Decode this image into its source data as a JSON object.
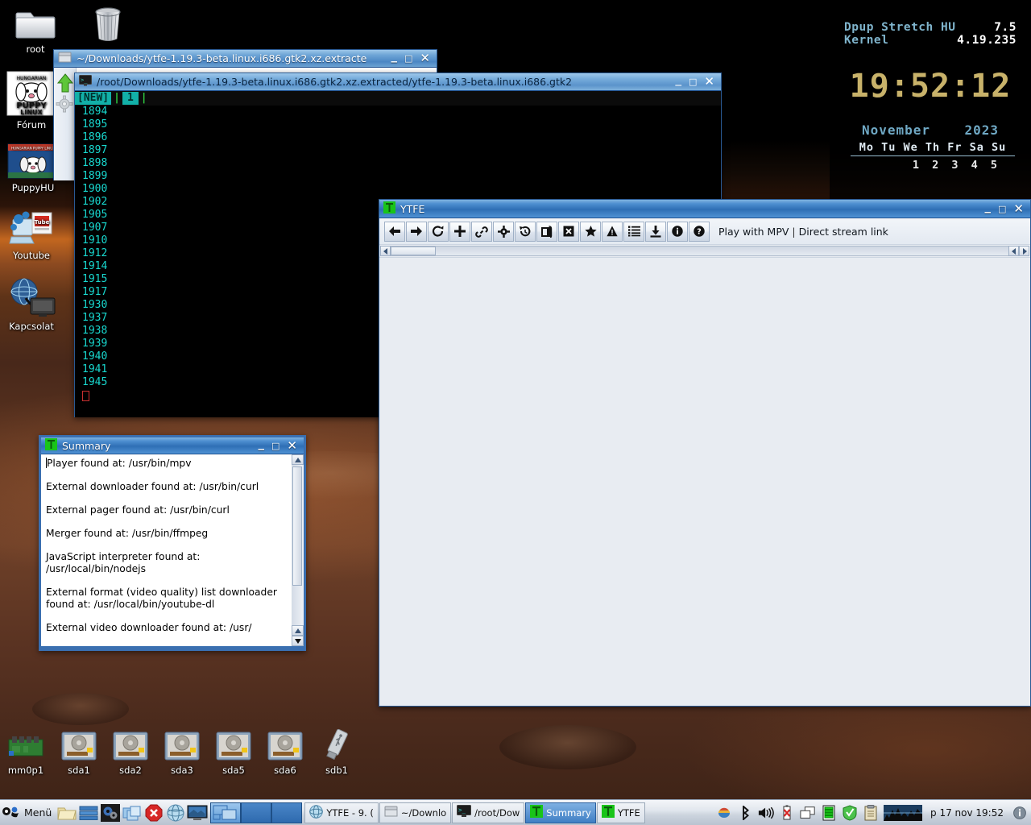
{
  "desktop": {
    "icons": [
      {
        "name": "root",
        "icon": "folder-icon"
      },
      {
        "name": "",
        "icon": "trash-icon"
      },
      {
        "name": "Fórum",
        "icon": "puppy-linux-forum-icon"
      },
      {
        "name": "PuppyHU",
        "icon": "puppyhu-icon"
      },
      {
        "name": "Youtube",
        "icon": "youtube-icon"
      },
      {
        "name": "Kapcsolat",
        "icon": "network-connect-icon"
      }
    ],
    "drives": [
      {
        "label": "mm0p1",
        "icon": "card-reader-icon"
      },
      {
        "label": "sda1",
        "icon": "harddisk-icon"
      },
      {
        "label": "sda2",
        "icon": "harddisk-icon"
      },
      {
        "label": "sda3",
        "icon": "harddisk-icon"
      },
      {
        "label": "sda5",
        "icon": "harddisk-icon"
      },
      {
        "label": "sda6",
        "icon": "harddisk-icon"
      },
      {
        "label": "sdb1",
        "icon": "usb-drive-icon"
      }
    ]
  },
  "conky": {
    "distro_label": "Dpup Stretch HU",
    "distro_version": "7.5",
    "kernel_label": "Kernel",
    "kernel_version": "4.19.235",
    "clock": "19:52:12",
    "month": "November",
    "year": "2023",
    "weekday_header": "Mo Tu We Th Fr Sa Su",
    "first_week": "1  2  3  4  5"
  },
  "filemanager": {
    "title": "~/Downloads/ytfe-1.19.3-beta.linux.i686.gtk2.xz.extracte",
    "icon": "folder-window-icon",
    "sidebar": [
      "up-arrow-icon",
      "gear-icon"
    ]
  },
  "terminal": {
    "title": "/root/Downloads/ytfe-1.19.3-beta.linux.i686.gtk2.xz.extracted/ytfe-1.19.3-beta.linux.i686.gtk2",
    "icon": "terminal-icon",
    "status_tag": "[NEW]",
    "status_num": "1",
    "lines": [
      "1894",
      "1895",
      "1896",
      "1897",
      "1898",
      "1899",
      "1900",
      "1902",
      "1905",
      "1907",
      "1910",
      "1912",
      "1914",
      "1915",
      "1917",
      "1930",
      "1937",
      "1938",
      "1939",
      "1940",
      "1941",
      "1945"
    ]
  },
  "ytfe": {
    "title": "YTFE",
    "icon": "ytfe-app-icon",
    "toolbar_buttons": [
      {
        "name": "back-button",
        "icon": "arrow-left-icon"
      },
      {
        "name": "forward-button",
        "icon": "arrow-right-icon"
      },
      {
        "name": "reload-button",
        "icon": "refresh-icon"
      },
      {
        "name": "add-button",
        "icon": "plus-icon"
      },
      {
        "name": "link-button",
        "icon": "link-icon"
      },
      {
        "name": "settings-button",
        "icon": "gear-icon"
      },
      {
        "name": "history-button",
        "icon": "history-clock-icon"
      },
      {
        "name": "copy-button",
        "icon": "copy-pages-icon"
      },
      {
        "name": "close-tab-button",
        "icon": "boxed-x-icon"
      },
      {
        "name": "favorites-button",
        "icon": "star-icon"
      },
      {
        "name": "warning-button",
        "icon": "warning-triangle-icon"
      },
      {
        "name": "playlist-button",
        "icon": "list-icon"
      },
      {
        "name": "download-button",
        "icon": "download-icon"
      },
      {
        "name": "info-button",
        "icon": "info-circle-icon"
      },
      {
        "name": "help-button",
        "icon": "question-circle-icon"
      }
    ],
    "play_link": "Play with MPV",
    "separator": "|",
    "stream_link": "Direct stream link"
  },
  "summary": {
    "title": "Summary",
    "icon": "ytfe-app-icon",
    "lines": [
      "Player found at: /usr/bin/mpv",
      "External downloader found at: /usr/bin/curl",
      "External pager found at: /usr/bin/curl",
      "Merger found at: /usr/bin/ffmpeg",
      "JavaScript interpreter found at: /usr/local/bin/nodejs",
      "External format (video quality) list downloader found at: /usr/local/bin/youtube-dl",
      "External video downloader found at: /usr/"
    ]
  },
  "taskbar": {
    "menu_label": "Menü",
    "launchers": [
      "folder-icon",
      "files-icon",
      "settings-icon",
      "windows-icon",
      "stop-icon",
      "browser-icon",
      "display-icon"
    ],
    "tasks": [
      {
        "label": "YTFE - 9. (",
        "icon": "browser-icon",
        "selected": false
      },
      {
        "label": "~/Downlo",
        "icon": "folder-icon",
        "selected": false
      },
      {
        "label": "/root/Dow",
        "icon": "terminal-icon",
        "selected": false
      },
      {
        "label": "Summary",
        "icon": "ytfe-app-icon",
        "selected": true
      },
      {
        "label": "YTFE",
        "icon": "ytfe-app-icon",
        "selected": false
      }
    ],
    "tray": [
      "color-palette-icon",
      "bluetooth-icon",
      "volume-icon",
      "battery-error-icon",
      "windows-switch-icon",
      "battery-full-icon",
      "shield-icon",
      "clipboard-icon",
      "network-graph-icon"
    ],
    "clock": "p 17 nov 19:52",
    "info_icon": "info-circle-icon"
  },
  "window_buttons": {
    "minimize": "_",
    "maximize": "□",
    "close": "✕"
  }
}
